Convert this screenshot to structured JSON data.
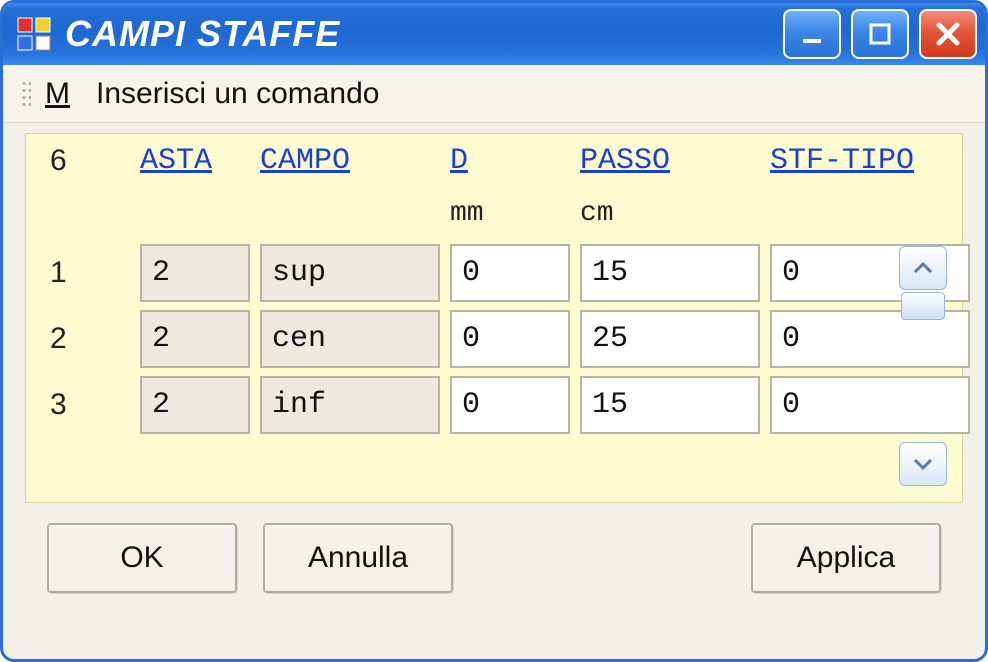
{
  "window": {
    "title": "CAMPI STAFFE"
  },
  "menubar": {
    "m": "M",
    "command": "Inserisci un comando"
  },
  "count": "6",
  "columns": {
    "asta": "ASTA",
    "campo": "CAMPO",
    "d": "D",
    "passo": "PASSO",
    "stftipo": "STF-TIPO"
  },
  "units": {
    "d": "mm",
    "passo": "cm"
  },
  "rows": [
    {
      "n": "1",
      "asta": "2",
      "campo": "sup",
      "d": "0",
      "passo": "15",
      "stftipo": "0"
    },
    {
      "n": "2",
      "asta": "2",
      "campo": "cen",
      "d": "0",
      "passo": "25",
      "stftipo": "0"
    },
    {
      "n": "3",
      "asta": "2",
      "campo": "inf",
      "d": "0",
      "passo": "15",
      "stftipo": "0"
    }
  ],
  "buttons": {
    "ok": "OK",
    "cancel": "Annulla",
    "apply": "Applica"
  }
}
